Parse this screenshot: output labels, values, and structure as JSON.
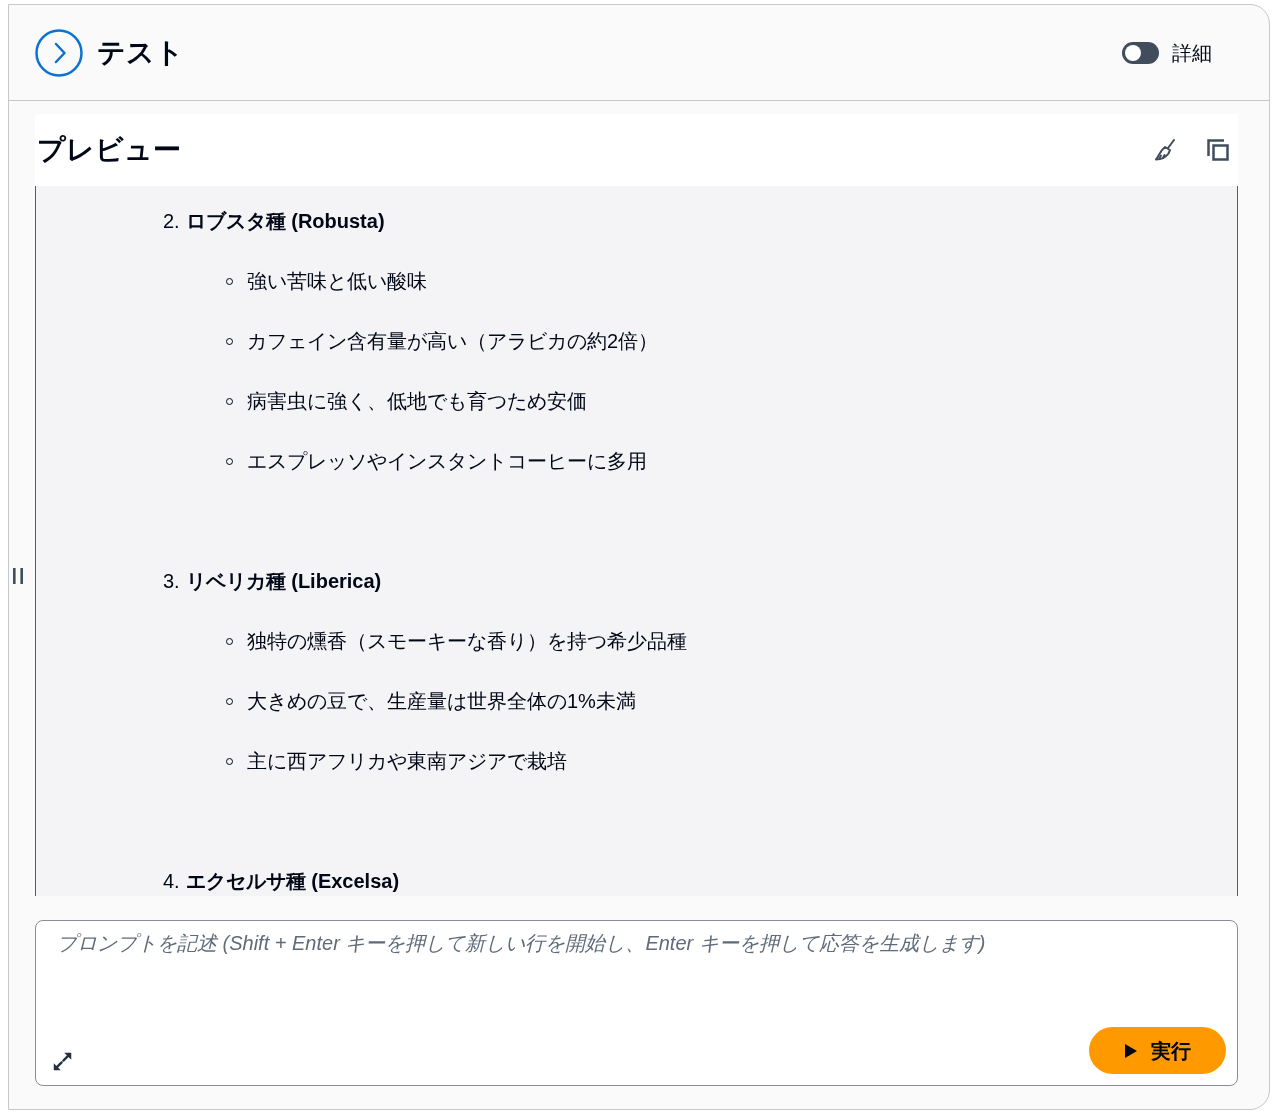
{
  "header": {
    "title": "テスト",
    "toggle": {
      "label": "詳細",
      "on": false
    }
  },
  "preview": {
    "title": "プレビュー",
    "items": [
      {
        "number": "2.",
        "title": "ロブスタ種 (Robusta)",
        "bullets": [
          "強い苦味と低い酸味",
          "カフェイン含有量が高い（アラビカの約2倍）",
          "病害虫に強く、低地でも育つため安価",
          "エスプレッソやインスタントコーヒーに多用"
        ]
      },
      {
        "number": "3.",
        "title": "リベリカ種 (Liberica)",
        "bullets": [
          "独特の燻香（スモーキーな香り）を持つ希少品種",
          "大きめの豆で、生産量は世界全体の1%未満",
          "主に西アフリカや東南アジアで栽培"
        ]
      },
      {
        "number": "4.",
        "title": "エクセルサ種 (Excelsa)"
      }
    ]
  },
  "prompt": {
    "placeholder": "プロンプトを記述 (Shift + Enter キーを押して新しい行を開始し、Enter キーを押して応答を生成します)",
    "run_button": "実行"
  }
}
